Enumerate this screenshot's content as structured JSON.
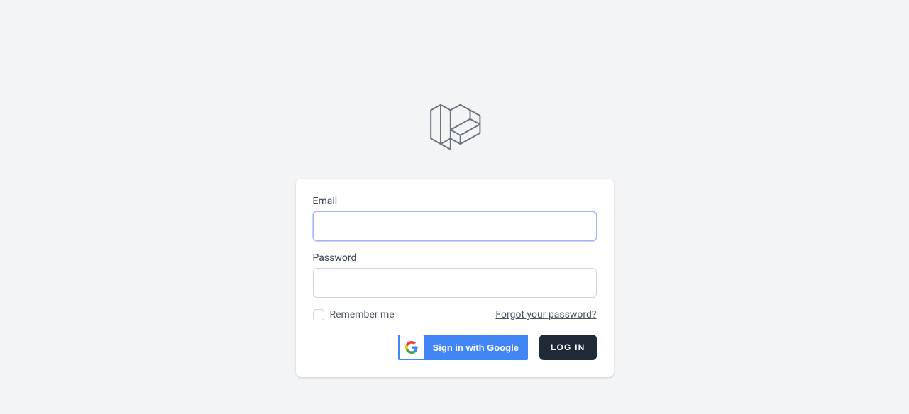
{
  "form": {
    "email_label": "Email",
    "email_value": "",
    "password_label": "Password",
    "password_value": "",
    "remember_label": "Remember me",
    "forgot_label": "Forgot your password?",
    "google_label": "Sign in with Google",
    "login_label": "LOG IN"
  }
}
